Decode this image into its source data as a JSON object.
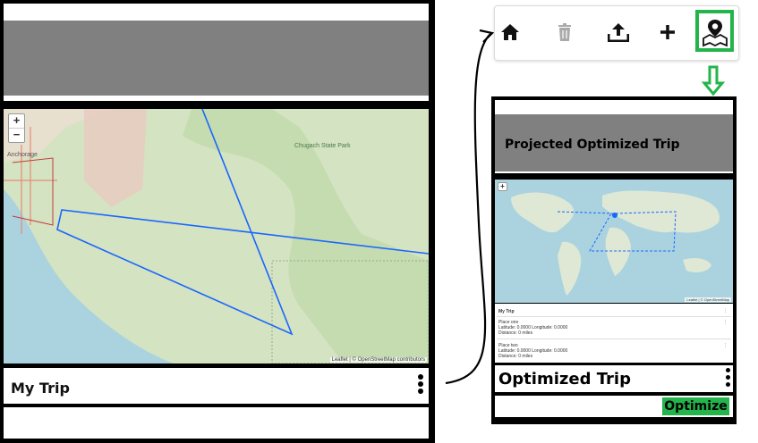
{
  "left_screen": {
    "map": {
      "zoom_in": "+",
      "zoom_out": "−",
      "attribution": "Leaflet | © OpenStreetMap contributors",
      "labels": [
        "Anchorage",
        "Chugach State Park"
      ]
    },
    "trip_title": "My Trip"
  },
  "toolbar": {
    "icons": [
      "home-icon",
      "trash-icon",
      "upload-icon",
      "plus-icon",
      "map-pin-icon"
    ]
  },
  "right_screen": {
    "header_title": "Projected Optimized Trip",
    "map": {
      "zoom_in": "+",
      "attribution": "Leaflet | © OpenStreetMap"
    },
    "list": {
      "header": "My Trip",
      "items": [
        {
          "line1": "Place one",
          "line2": "Latitude: 0.0000 Longitude: 0.0000",
          "line3": "Distance: 0 miles"
        },
        {
          "line1": "Place two",
          "line2": "Latitude: 0.0000 Longitude: 0.0000",
          "line3": "Distance: 0 miles"
        }
      ]
    },
    "trip_title": "Optimized Trip",
    "optimize_label": "Optimize"
  },
  "colors": {
    "accent": "#23b44b",
    "header_gray": "#808080",
    "route": "#1a66ff"
  }
}
